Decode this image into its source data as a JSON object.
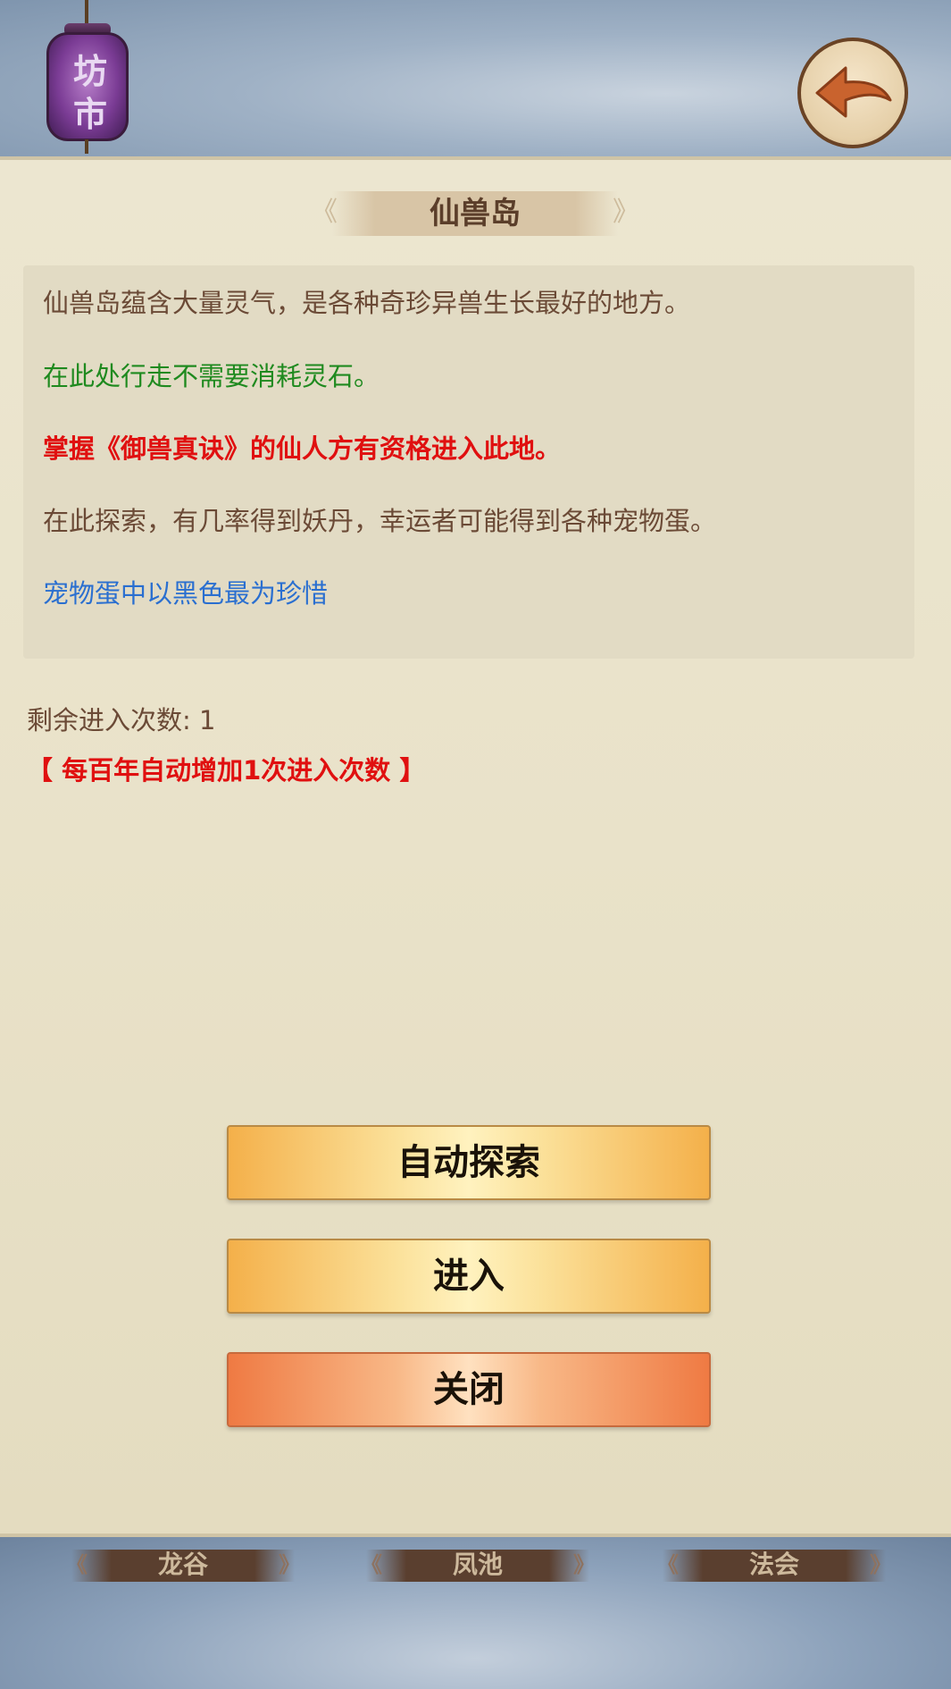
{
  "header": {
    "lantern_chars": [
      "坊",
      "市"
    ],
    "back_icon": "back-arrow-icon"
  },
  "panel": {
    "title": "仙兽岛",
    "description": [
      "仙兽岛蕴含大量灵气，是各种奇珍异兽生长最好的地方。",
      "在此处行走不需要消耗灵石。",
      "掌握《御兽真诀》的仙人方有资格进入此地。",
      "在此探索，有几率得到妖丹，幸运者可能得到各种宠物蛋。",
      "宠物蛋中以黑色最为珍惜"
    ],
    "remaining_label": "剩余进入次数: 1",
    "increment_note": "【 每百年自动增加1次进入次数 】"
  },
  "buttons": {
    "auto_explore": "自动探索",
    "enter": "进入",
    "close": "关闭"
  },
  "bottom_tabs": [
    "龙谷",
    "凤池",
    "法会"
  ],
  "colors": {
    "green_text": "#1f8a1f",
    "red_text": "#e01010",
    "blue_text": "#2a6fd0",
    "brown_text": "#6b4a36"
  }
}
